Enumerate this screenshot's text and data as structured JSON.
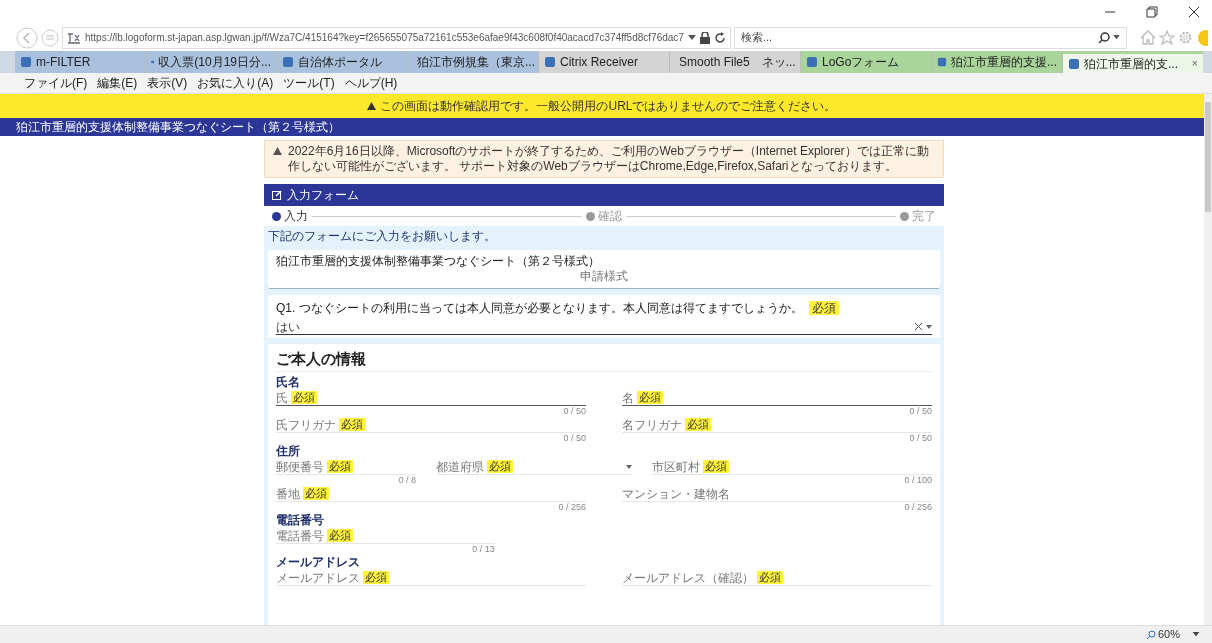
{
  "browser": {
    "url": "https://lb.logoform.st-japan.asp.lgwan.jp/f/Wza7C/415164?key=f265655075a72161c553e6afae9f43c608f0f40acacd7c374ff5d8cf76dac7",
    "search": {
      "placeholder": "検索..."
    },
    "tabs": [
      {
        "label": "m-FILTER",
        "color": "#a9c1dd",
        "selected": false
      },
      {
        "label": "収入票(10月19日分...",
        "color": "#a9c1dd",
        "selected": false
      },
      {
        "label": "自治体ポータル",
        "color": "#a9c1dd",
        "selected": false
      },
      {
        "label": "狛江市例規集（東京...",
        "color": "#a9c1dd",
        "selected": false
      },
      {
        "label": "Citrix Receiver",
        "color": "#d4d4d4",
        "selected": false
      },
      {
        "label": "Smooth File5　ネッ...",
        "color": "#d4d4d4",
        "selected": false
      },
      {
        "label": "LoGoフォーム",
        "color": "#a9d59a",
        "selected": false
      },
      {
        "label": "狛江市重層的支援...",
        "color": "#a9d59a",
        "selected": false
      },
      {
        "label": "狛江市重層的支...",
        "color": "#a9d59a",
        "selected": true,
        "close": "×"
      }
    ],
    "menu": [
      "ファイル(F)",
      "編集(E)",
      "表示(V)",
      "お気に入り(A)",
      "ツール(T)",
      "ヘルプ(H)"
    ],
    "zoom": "60%"
  },
  "page": {
    "banner": "この画面は動作確認用です。一般公開用のURLではありませんのでご注意ください。",
    "title_bar": "狛江市重層的支援体制整備事業つなぐシート（第２号様式）",
    "notice": "2022年6月16日以降、Microsoftのサポートが終了するため、ご利用のWebブラウザー（Internet Explorer）では正常に動作しない可能性がございます。 サポート対象のWebブラウザーはChrome,Edge,Firefox,Safariとなっております。",
    "form_header": "入力フォーム",
    "steps": [
      {
        "label": "入力",
        "selected": true
      },
      {
        "label": "確認",
        "selected": false
      },
      {
        "label": "完了",
        "selected": false
      }
    ],
    "instruction": "下記のフォームにご入力をお願いします。",
    "form_title": "狛江市重層的支援体制整備事業つなぐシート（第２号様式）",
    "form_subtitle": "申請様式",
    "question": {
      "text": "Q1. つなぐシートの利用に当っては本人同意が必要となります。本人同意は得てますでしょうか。",
      "badge": "必須",
      "value": "はい"
    },
    "section": {
      "heading": "ご本人の情報",
      "groups": [
        {
          "label": "氏名",
          "rows": [
            {
              "kind": "pair",
              "fields": [
                {
                  "kind": "text",
                  "label": "氏",
                  "badge": "必須",
                  "counter": "0 / 50",
                  "focused": true
                },
                {
                  "kind": "text",
                  "label": "名",
                  "badge": "必須",
                  "counter": "0 / 50",
                  "focused": true
                }
              ]
            },
            {
              "kind": "pair",
              "fields": [
                {
                  "kind": "text",
                  "label": "氏フリガナ",
                  "badge": "必須",
                  "counter": "0 / 50",
                  "focused": false
                },
                {
                  "kind": "text",
                  "label": "名フリガナ",
                  "badge": "必須",
                  "counter": "0 / 50",
                  "focused": false
                }
              ]
            }
          ]
        },
        {
          "label": "住所",
          "rows": [
            {
              "kind": "triple",
              "fields": [
                {
                  "kind": "text",
                  "label": "郵便番号",
                  "badge": "必須",
                  "counter": "0 / 8",
                  "focused": false
                },
                {
                  "kind": "select",
                  "label": "都道府県",
                  "badge": "必須",
                  "focused": false
                },
                {
                  "kind": "text",
                  "label": "市区町村",
                  "badge": "必須",
                  "counter": "0 / 100",
                  "focused": false
                }
              ]
            },
            {
              "kind": "pair",
              "fields": [
                {
                  "kind": "text",
                  "label": "番地",
                  "badge": "必須",
                  "counter": "0 / 256",
                  "focused": false
                },
                {
                  "kind": "text",
                  "label": "マンション・建物名",
                  "counter": "0 / 256",
                  "focused": false
                }
              ]
            }
          ]
        },
        {
          "label": "電話番号",
          "rows": [
            {
              "kind": "single",
              "fields": [
                {
                  "kind": "text",
                  "label": "電話番号",
                  "badge": "必須",
                  "counter": "0 / 13",
                  "focused": false
                }
              ]
            }
          ]
        },
        {
          "label": "メールアドレス",
          "rows": [
            {
              "kind": "pair",
              "fields": [
                {
                  "kind": "text",
                  "label": "メールアドレス",
                  "badge": "必須",
                  "focused": false
                },
                {
                  "kind": "text",
                  "label": "メールアドレス（確認）",
                  "badge": "必須",
                  "focused": false
                }
              ]
            }
          ]
        }
      ]
    }
  }
}
